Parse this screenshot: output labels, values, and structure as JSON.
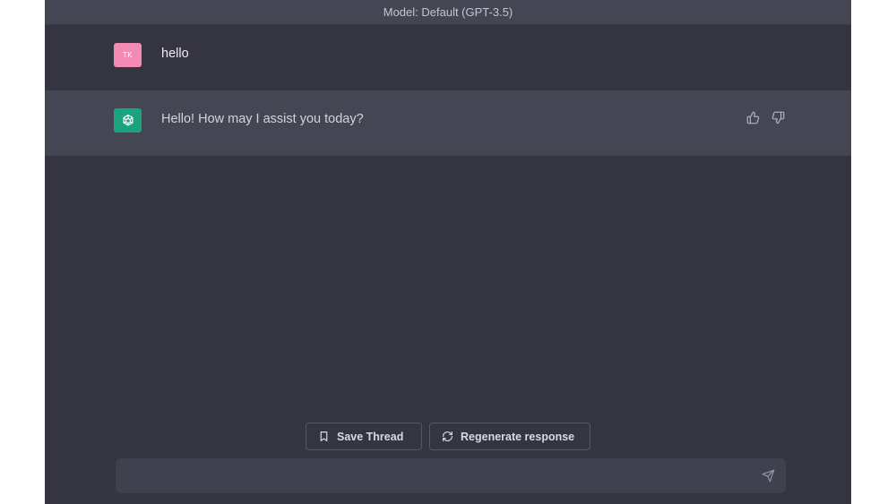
{
  "header": {
    "model_label": "Model: Default (GPT-3.5)"
  },
  "messages": [
    {
      "role": "user",
      "avatar_initials": "TK",
      "text": "hello"
    },
    {
      "role": "assistant",
      "avatar_icon": "openai-logo-icon",
      "text": "Hello! How may I assist you today?"
    }
  ],
  "feedback": {
    "icons": [
      "thumbs-up-icon",
      "thumbs-down-icon"
    ]
  },
  "actions": {
    "save_label": "Save Thread",
    "save_icon": "bookmark-icon",
    "regenerate_label": "Regenerate response",
    "regenerate_icon": "refresh-icon"
  },
  "composer": {
    "value": "",
    "placeholder": "",
    "send_icon": "send-icon"
  },
  "colors": {
    "background": "#343541",
    "assistant_row": "#444654",
    "user_avatar": "#f28ab4",
    "bot_avatar": "#19a37f",
    "composer": "#40414f"
  }
}
